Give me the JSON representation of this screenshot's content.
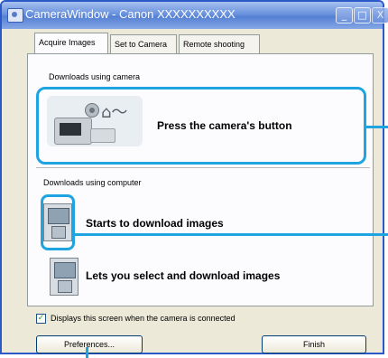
{
  "window": {
    "title": "CameraWindow - Canon XXXXXXXXXX",
    "controls": [
      "_",
      "□",
      "X"
    ]
  },
  "tabs": [
    {
      "label": "Acquire Images",
      "active": true
    },
    {
      "label": "Set to Camera",
      "active": false
    },
    {
      "label": "Remote shooting",
      "active": false
    }
  ],
  "sections": {
    "camera": {
      "label": "Downloads using camera",
      "action": "Press the camera's button"
    },
    "computer": {
      "label": "Downloads using computer",
      "actions": [
        "Starts to download images",
        "Lets you select and download images"
      ]
    }
  },
  "options": {
    "show_on_connect": "Displays this screen when the camera is connected",
    "show_on_connect_checked": true
  },
  "buttons": {
    "preferences": "Preferences...",
    "finish": "Finish"
  },
  "colors": {
    "highlight": "#1ea4e0",
    "titlebar": "#5580d3"
  }
}
